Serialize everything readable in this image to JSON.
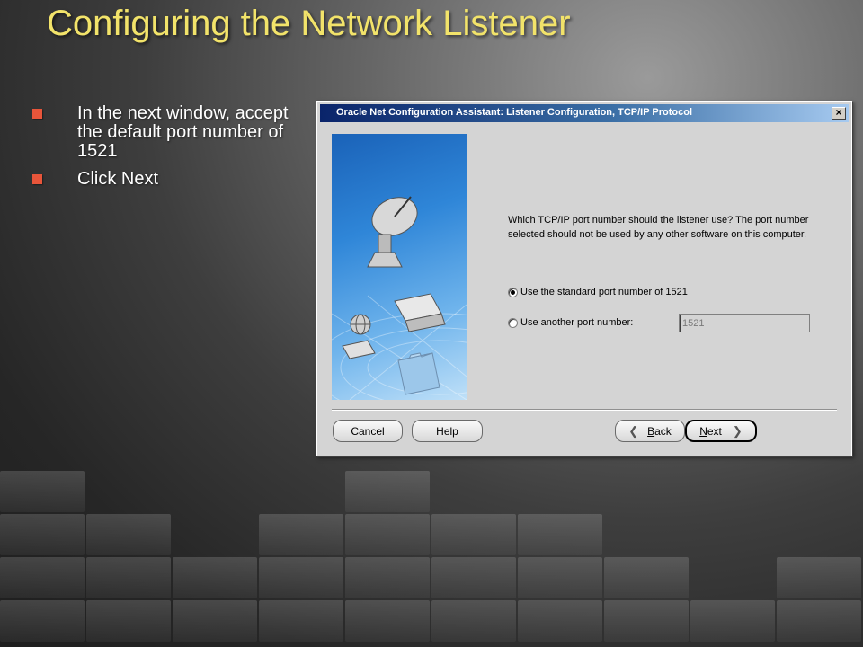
{
  "slide": {
    "title": "Configuring the Network Listener",
    "bullets": [
      "In the next window, accept the default port number of 1521",
      "Click Next"
    ]
  },
  "dialog": {
    "title": "Oracle Net Configuration Assistant: Listener Configuration, TCP/IP Protocol",
    "close_label": "×",
    "question": "Which TCP/IP port number should the listener use? The port number selected should not be used by any other software on this computer.",
    "options": [
      {
        "label": "Use the standard port number of 1521",
        "checked": true
      },
      {
        "label": "Use another port number:",
        "checked": false
      }
    ],
    "port_value": "1521",
    "buttons": {
      "cancel": "Cancel",
      "help": "Help",
      "back_key": "B",
      "back_rest": "ack",
      "next_key": "N",
      "next_rest": "ext"
    },
    "icons": [
      "satellite-dish-icon",
      "globe-icon",
      "computer-icon",
      "folder-icon"
    ]
  },
  "colors": {
    "title_yellow": "#f2e36a",
    "bullet_red": "#e8553a",
    "titlebar_blue": "#0a246a"
  }
}
